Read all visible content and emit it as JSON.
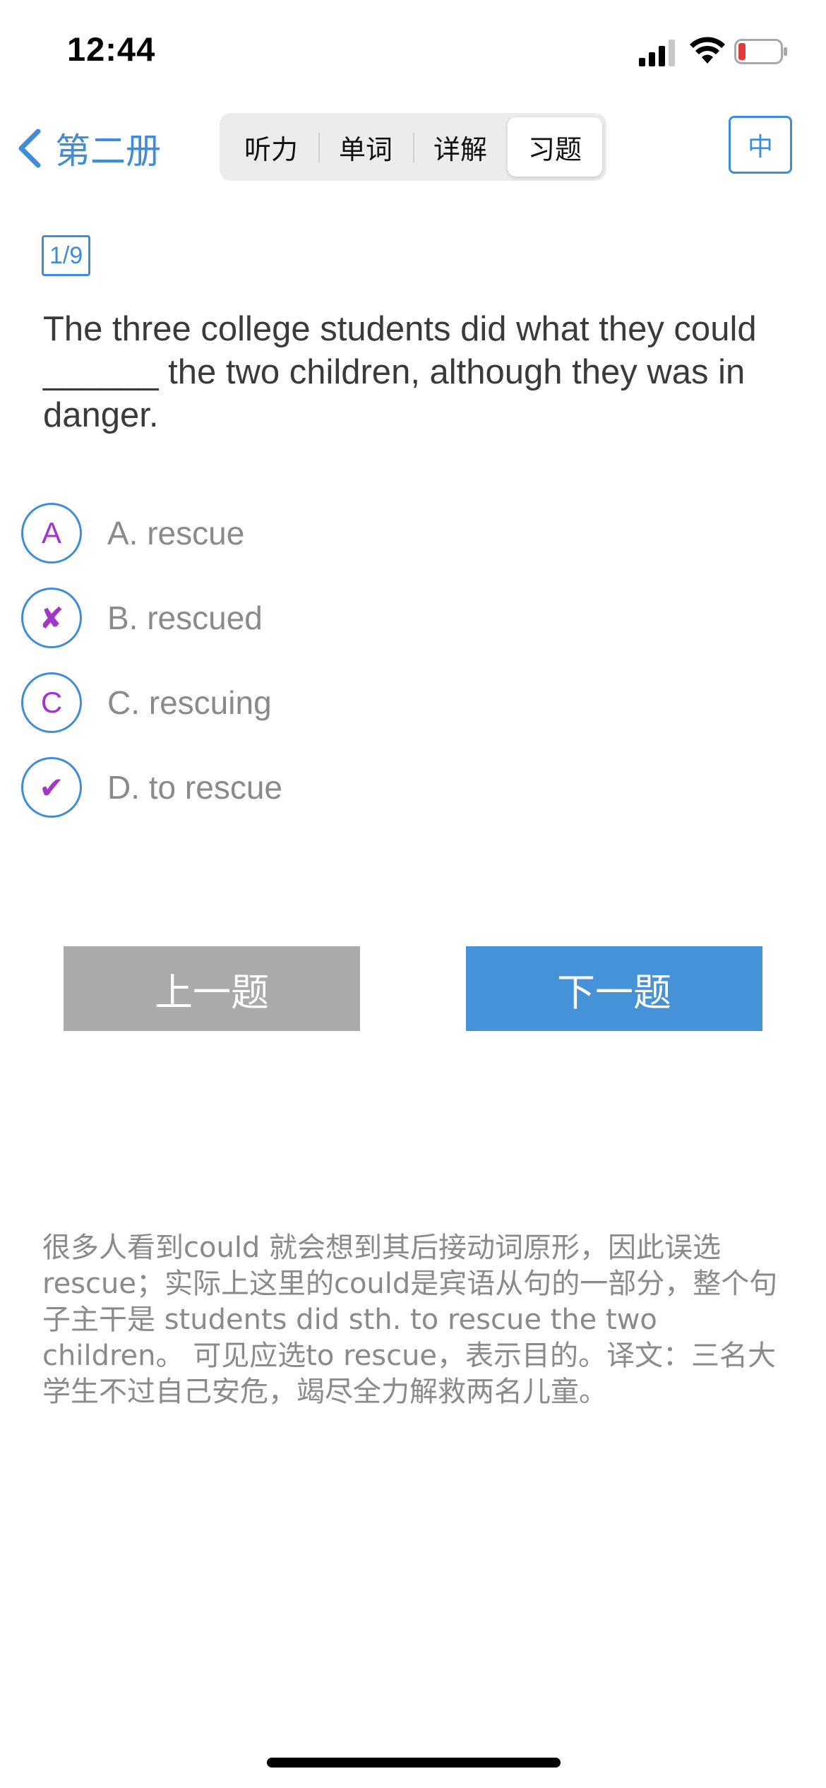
{
  "status_bar": {
    "time": "12:44",
    "icons": [
      "signal-icon",
      "wifi-icon",
      "battery-low-icon"
    ]
  },
  "nav": {
    "back_label": "第二册",
    "tabs": [
      {
        "label": "听力",
        "active": false
      },
      {
        "label": "单词",
        "active": false
      },
      {
        "label": "详解",
        "active": false
      },
      {
        "label": "习题",
        "active": true
      }
    ],
    "lang_label": "中"
  },
  "question": {
    "counter": "1/9",
    "text": "The three college students did what they could ______ the two children, although they was in danger.",
    "options": [
      {
        "mark": "A",
        "mark_type": "letter",
        "text": "A. rescue"
      },
      {
        "mark": "✘",
        "mark_type": "wrong",
        "text": "B. rescued"
      },
      {
        "mark": "C",
        "mark_type": "letter",
        "text": "C. rescuing"
      },
      {
        "mark": "✔",
        "mark_type": "correct",
        "text": "D. to rescue"
      }
    ]
  },
  "buttons": {
    "prev_label": "上一题",
    "next_label": "下一题"
  },
  "explanation": "很多人看到could 就会想到其后接动词原形，因此误选rescue；实际上这里的could是宾语从句的一部分，整个句子主干是 students did sth. to rescue the two children。 可见应选to rescue，表示目的。译文：三名大学生不过自己安危，竭尽全力解救两名儿童。",
  "colors": {
    "accent": "#3f8dd8",
    "mark": "#a236c9",
    "prev_button": "#aaaaaa",
    "next_button": "#4592d9",
    "battery_low": "#e03b3b"
  }
}
